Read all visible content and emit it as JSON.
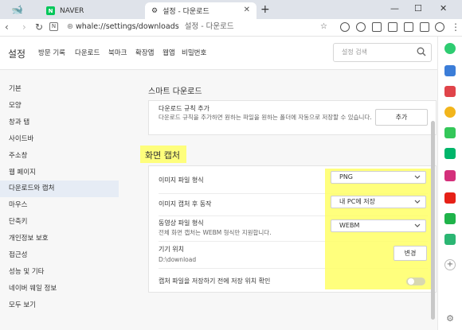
{
  "browser": {
    "tabs": [
      {
        "label": "NAVER",
        "favicon": "N"
      },
      {
        "label": "설정 - 다운로드"
      }
    ],
    "url": "whale://settings/downloads",
    "page_title": "설정 - 다운로드"
  },
  "settings": {
    "title": "설정",
    "top_nav": [
      "방문 기록",
      "다운로드",
      "북마크",
      "확장앱",
      "웹앱",
      "비밀번호"
    ],
    "search_placeholder": "설정 검색",
    "sidebar_items": [
      "기본",
      "모양",
      "창과 탭",
      "사이드바",
      "주소창",
      "웹 페이지",
      "다운로드와 캡처",
      "마우스",
      "단축키",
      "개인정보 보호",
      "접근성",
      "성능 및 기타",
      "네이버 웨일 정보",
      "모두 보기"
    ],
    "selected_sidebar_item": "다운로드와 캡처"
  },
  "smart_download": {
    "heading": "스마트 다운로드",
    "rule_title": "다운로드 규칙 추가",
    "rule_desc": "다운로드 규칙을 추가하면 원하는 파일을 원하는 폴더에 자동으로 저장할 수 있습니다.",
    "add_button": "추가"
  },
  "screen_capture": {
    "heading": "화면 캡처",
    "image_format_label": "이미지 파일 형식",
    "image_format_value": "PNG",
    "after_capture_label": "이미지 캡처 후 동작",
    "after_capture_value": "내 PC에 저장",
    "video_format_label": "동영상 파일 형식",
    "video_format_desc": "전체 화면 캡처는 WEBM 형식만 지원합니다.",
    "video_format_value": "WEBM",
    "location_label": "기기 위치",
    "location_value": "D:\\download",
    "change_button": "변경",
    "confirm_label": "캡처 파일을 저장하기 전에 저장 위치 확인",
    "confirm_toggle": false
  },
  "colors": {
    "highlight": "#ffff66",
    "naver_green": "#03c75a"
  }
}
